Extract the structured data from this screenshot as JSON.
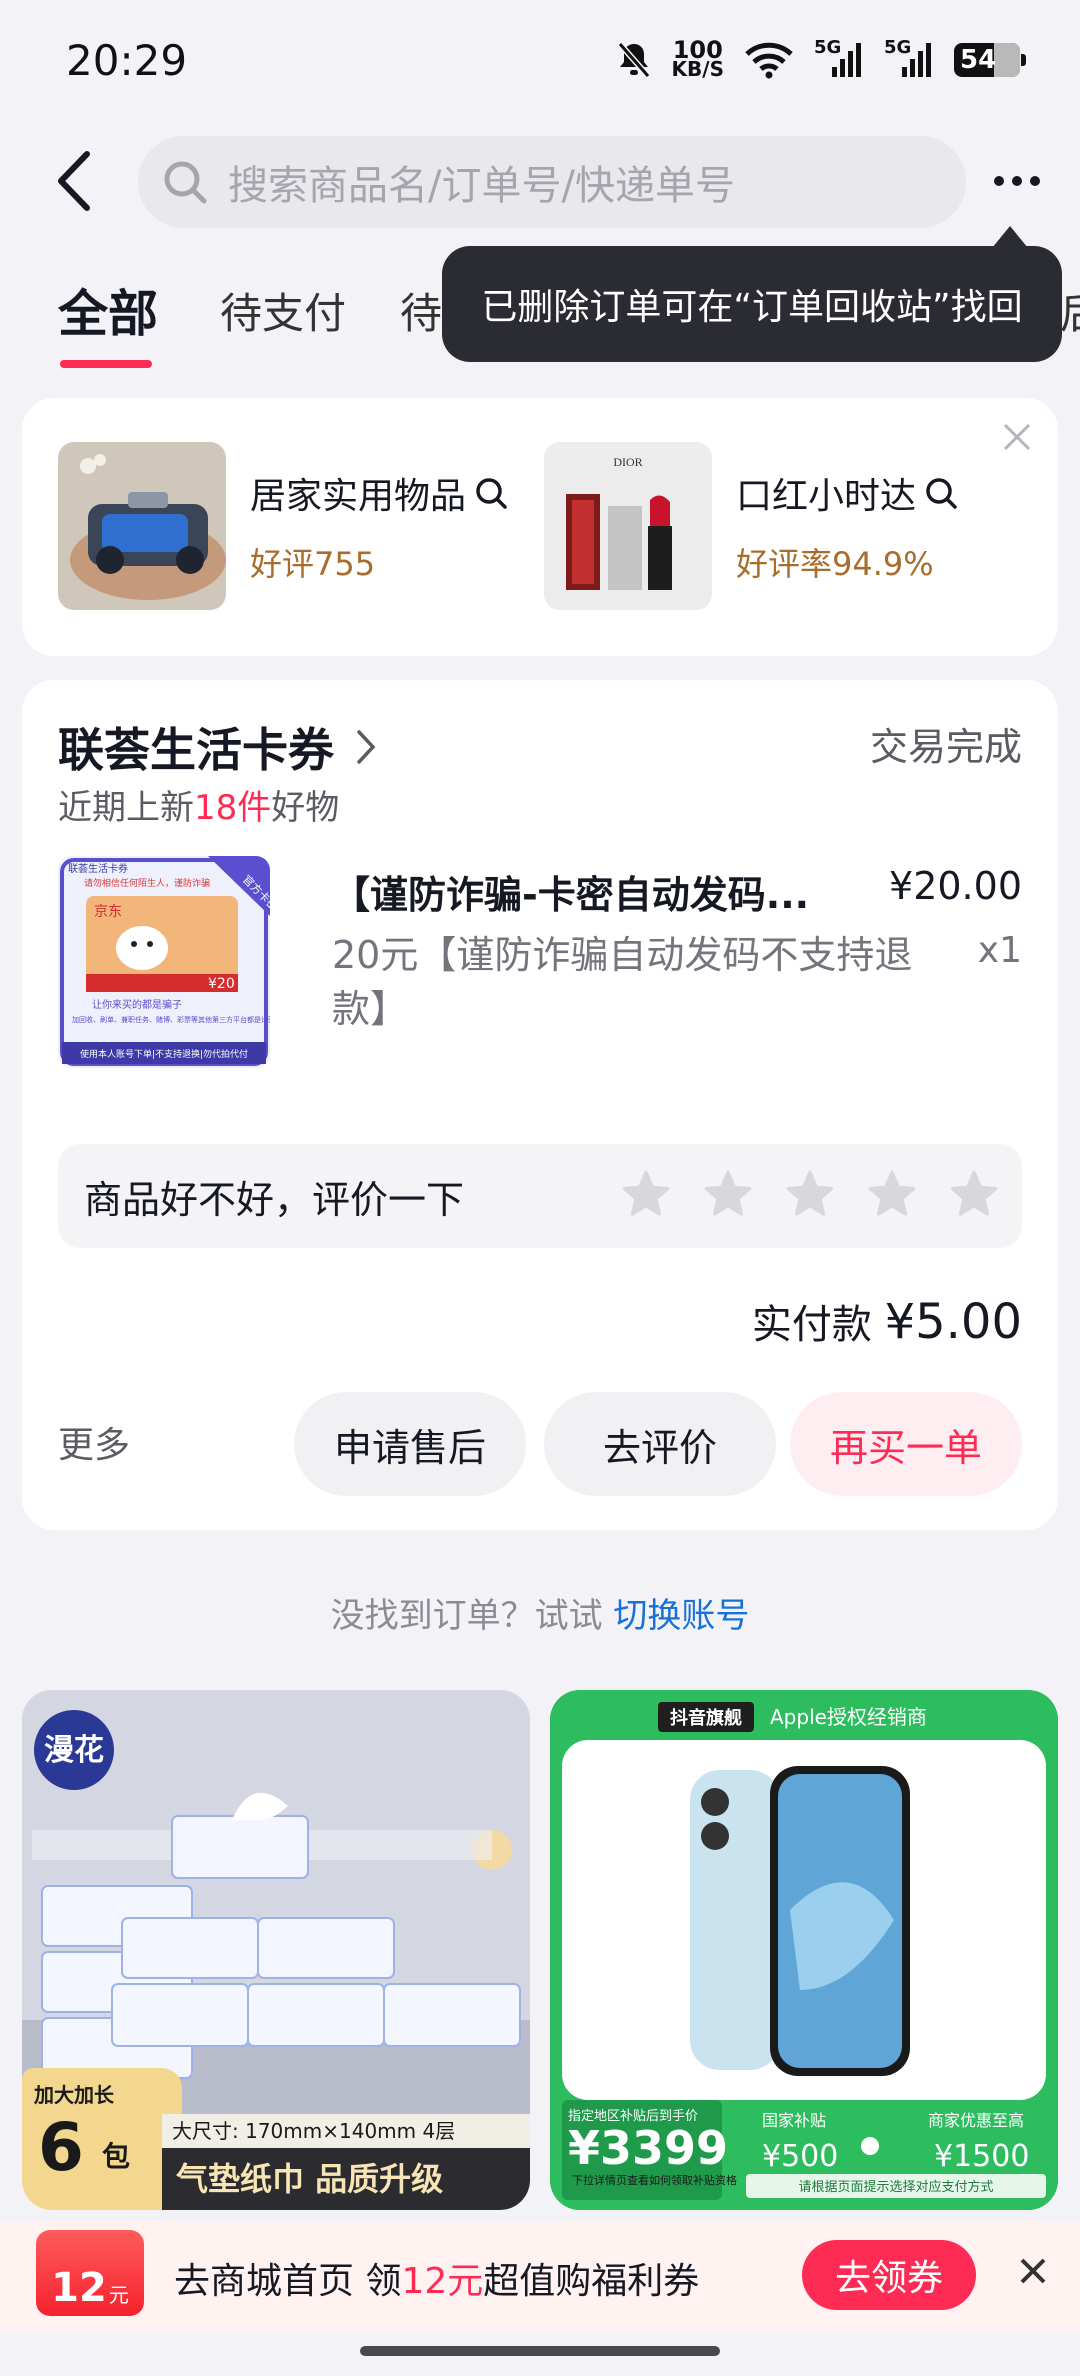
{
  "status_bar": {
    "time": "20:29",
    "net_speed_value": "100",
    "net_speed_unit": "KB/S",
    "signal_1": "5G",
    "signal_2": "5G",
    "battery": "54"
  },
  "header": {
    "search_placeholder": "搜索商品名/订单号/快递单号"
  },
  "tabs": [
    {
      "label": "全部",
      "active": true
    },
    {
      "label": "待支付"
    },
    {
      "label": "待"
    },
    {
      "label": "后"
    }
  ],
  "tooltip": {
    "text": "已删除订单可在“订单回收站”找回"
  },
  "recommendations": [
    {
      "title": "居家实用物品",
      "subtitle": "好评755"
    },
    {
      "title": "口红小时达",
      "subtitle": "好评率94.9%"
    }
  ],
  "order": {
    "shop_name": "联荟生活卡券",
    "status": "交易完成",
    "subtitle_prefix": "近期上新",
    "subtitle_count": "18件",
    "subtitle_suffix": "好物",
    "product_title": "【谨防诈骗-卡密自动发码...",
    "product_price": "¥20.00",
    "product_desc": "20元【谨防诈骗自动发码不支持退款】",
    "product_qty": "x1",
    "image_brand": "京东",
    "image_amount": "¥20",
    "image_tag": "官方卡密",
    "image_header": "联荟生活卡券",
    "image_warning": "请勿相信任何陌生人，谨防诈骗",
    "image_slogan": "让你来买的都是骗子",
    "image_note": "加回收、刷单、兼职任务、赌博、彩票等其他第三方平台都是诈骗",
    "image_footer": "使用本人账号下单|不支持退换|勿代拍代付",
    "rate_prompt": "商品好不好，评价一下",
    "paid_label": "实付款",
    "paid_amount": "¥5.00",
    "more_label": "更多",
    "buttons": {
      "after_sale": "申请售后",
      "review": "去评价",
      "buy_again": "再买一单"
    }
  },
  "hint": {
    "text": "没找到订单？试试",
    "link": "切换账号"
  },
  "feed": [
    {
      "brand": "漫花",
      "badge_top": "加大加长",
      "badge_num": "6",
      "badge_unit": "包",
      "size_text": "大尺寸: 170mm×140mm 4层",
      "slogan": "气垫纸巾 品质升级"
    },
    {
      "store_tag": "抖音旗舰",
      "store_text": "Apple授权经销商",
      "price_label": "指定地区补贴后到手价",
      "price": "¥3399",
      "price_note": "下拉详情页查看如何领取补贴资格",
      "subsidy_label": "国家补贴",
      "subsidy_value": "¥500",
      "discount_label": "商家优惠至高",
      "discount_value": "¥1500",
      "footnote": "请根据页面提示选择对应支付方式"
    }
  ],
  "bottom_banner": {
    "coupon_num": "12",
    "coupon_unit": "元",
    "text_prefix": "去商城首页 领",
    "text_amount": "12元",
    "text_suffix": "超值购福利券",
    "button": "去领券"
  },
  "colors": {
    "accent": "#fe2c55",
    "link": "#1771d6",
    "tooltip_bg": "#2b2c33",
    "background": "#f3f3f7"
  }
}
